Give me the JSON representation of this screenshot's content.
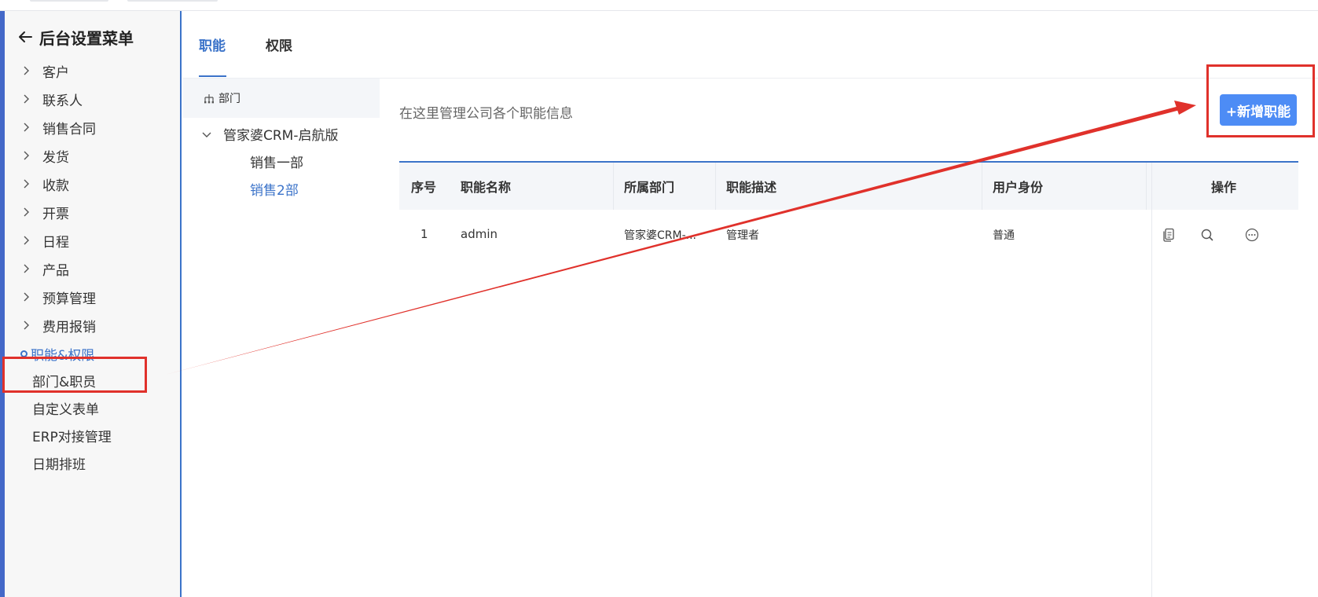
{
  "sidebar": {
    "title": "后台设置菜单",
    "items": [
      {
        "label": "客户"
      },
      {
        "label": "联系人"
      },
      {
        "label": "销售合同"
      },
      {
        "label": "发货"
      },
      {
        "label": "收款"
      },
      {
        "label": "开票"
      },
      {
        "label": "日程"
      },
      {
        "label": "产品"
      },
      {
        "label": "预算管理"
      },
      {
        "label": "费用报销"
      }
    ],
    "active_item": "职能&权限",
    "plain_items": [
      {
        "label": "部门&职员"
      },
      {
        "label": "自定义表单"
      },
      {
        "label": "ERP对接管理"
      },
      {
        "label": "日期排班"
      }
    ]
  },
  "tabs": [
    {
      "label": "职能"
    },
    {
      "label": "权限"
    }
  ],
  "dept_panel": {
    "header": "部门",
    "root": "管家婆CRM-启航版",
    "children": [
      {
        "label": "销售一部"
      },
      {
        "label": "销售2部"
      }
    ],
    "selected": "销售2部"
  },
  "content": {
    "description": "在这里管理公司各个职能信息",
    "add_button": "+新增职能"
  },
  "table": {
    "columns": [
      "序号",
      "职能名称",
      "所属部门",
      "职能描述",
      "用户身份",
      "操作"
    ],
    "rows": [
      {
        "index": "1",
        "name": "admin",
        "department": "管家婆CRM-...",
        "description": "管理者",
        "identity": "普通"
      }
    ]
  },
  "colors": {
    "accent": "#3b73c9",
    "button": "#4d8cf5",
    "annotation": "#e0312b"
  }
}
